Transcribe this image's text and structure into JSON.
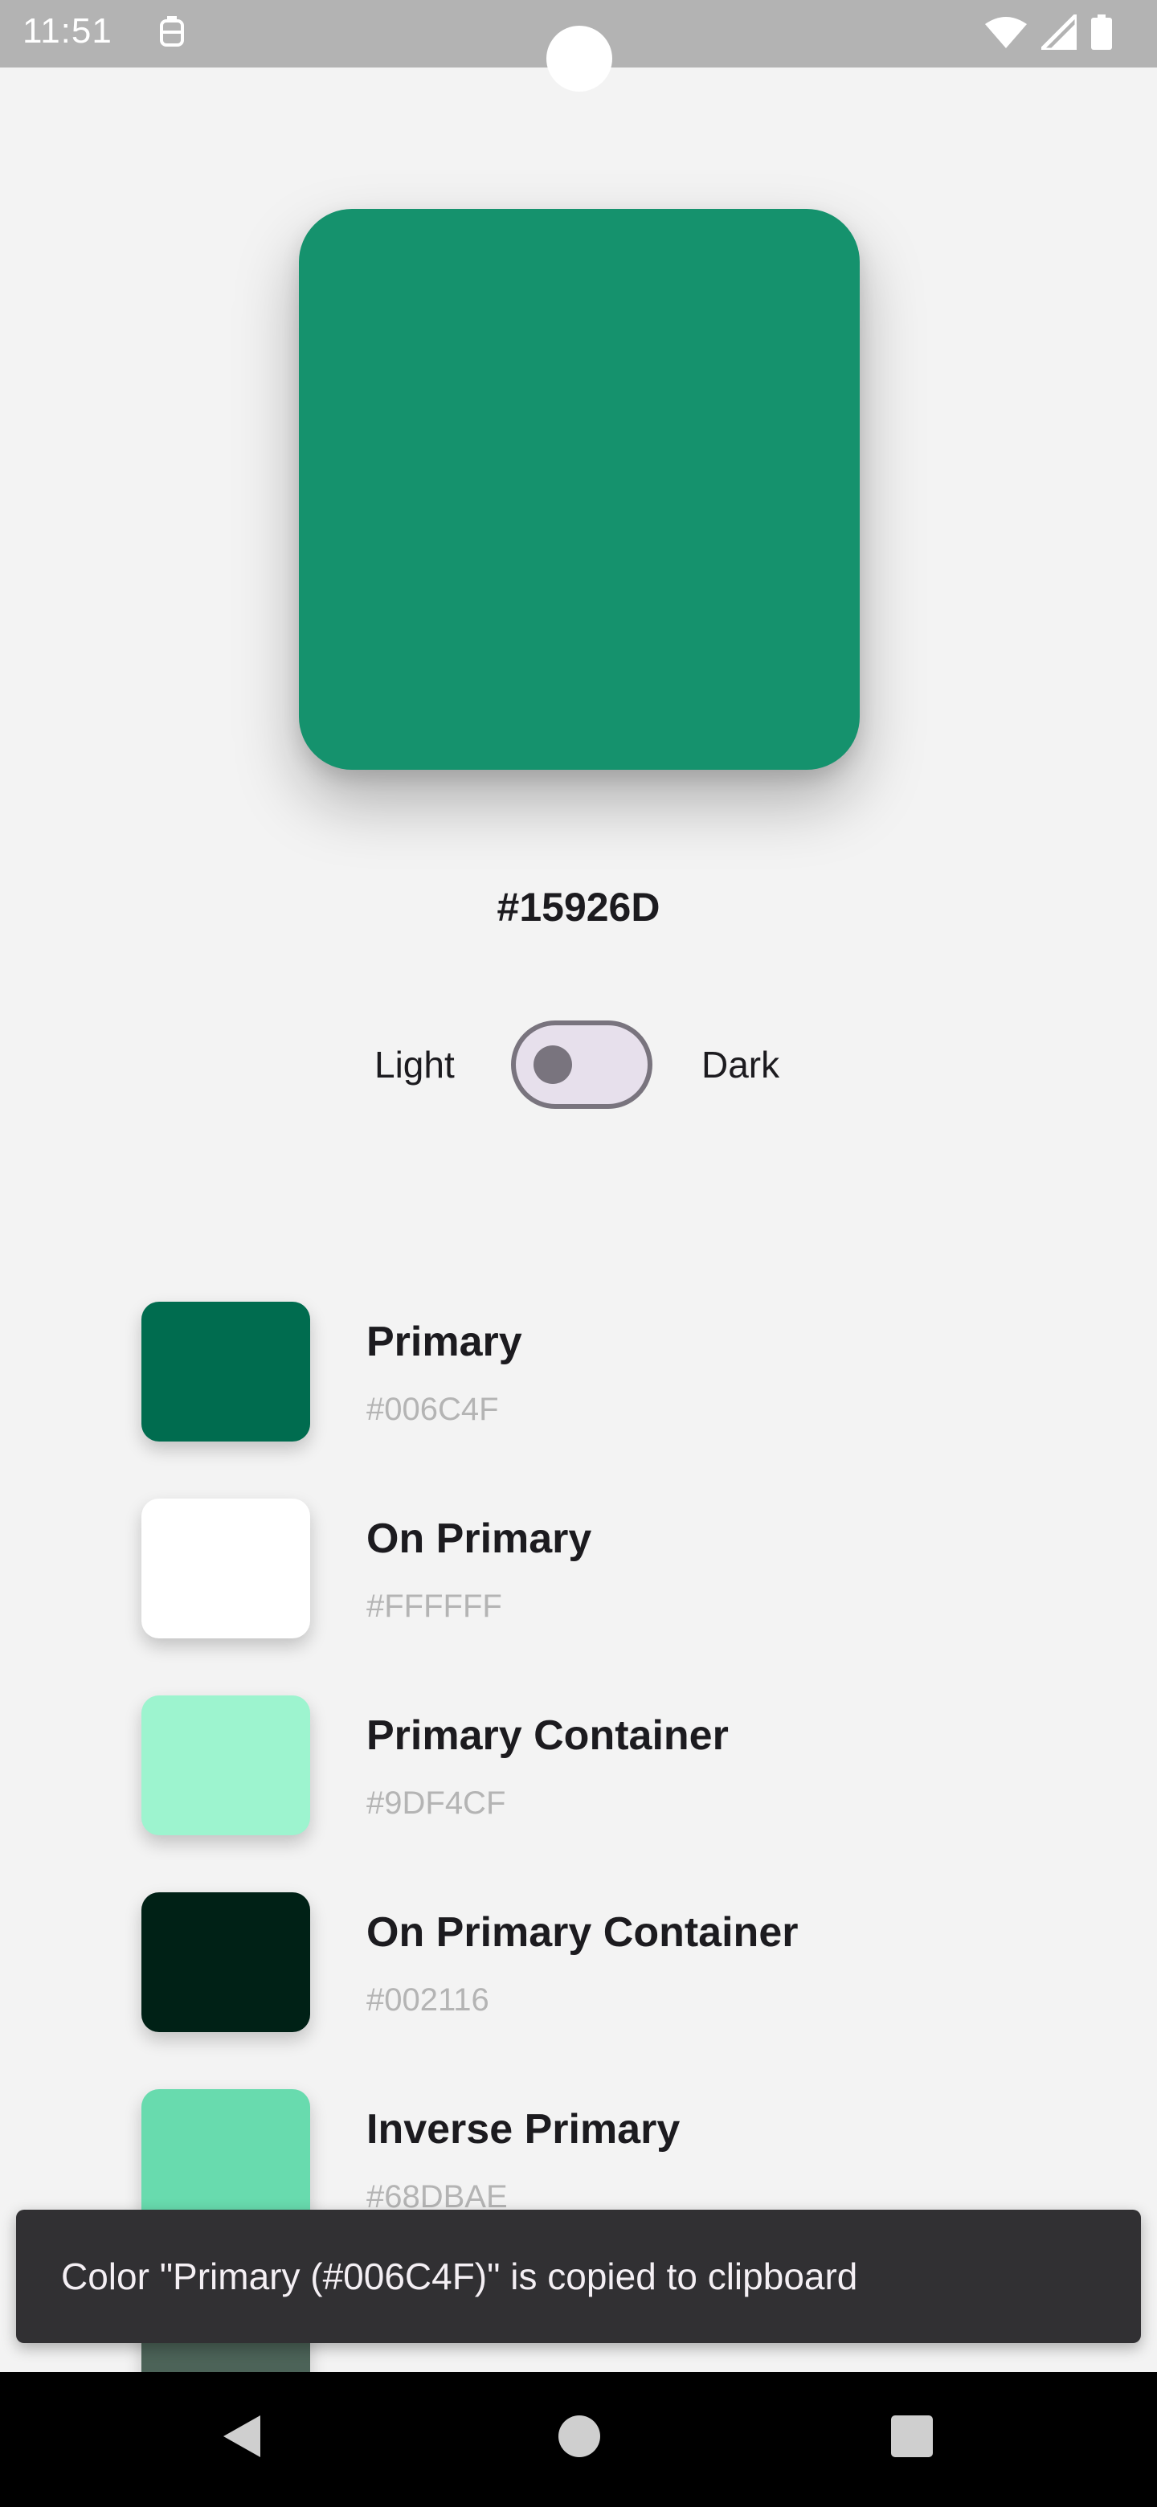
{
  "status_bar": {
    "time": "11:51",
    "icons": [
      "notification-icon",
      "wifi-icon",
      "signal-icon",
      "battery-icon"
    ]
  },
  "hero": {
    "color": "#15926D",
    "hex_label": "#15926D"
  },
  "theme_toggle": {
    "light_label": "Light",
    "dark_label": "Dark",
    "is_dark": false
  },
  "color_roles": [
    {
      "name": "Primary",
      "hex": "#006C4F",
      "color": "#006C4F"
    },
    {
      "name": "On Primary",
      "hex": "#FFFFFF",
      "color": "#FFFFFF"
    },
    {
      "name": "Primary Container",
      "hex": "#9DF4CF",
      "color": "#9DF4CF"
    },
    {
      "name": "On Primary Container",
      "hex": "#002116",
      "color": "#002116"
    },
    {
      "name": "Inverse Primary",
      "hex": "#68DBAE",
      "color": "#68DBAE"
    }
  ],
  "partial_next_item": {
    "color": "#4C6358"
  },
  "snackbar": {
    "message": "Color \"Primary (#006C4F)\" is copied to clipboard"
  },
  "nav_bar": {
    "buttons": [
      "back-icon",
      "home-icon",
      "recents-icon"
    ]
  }
}
